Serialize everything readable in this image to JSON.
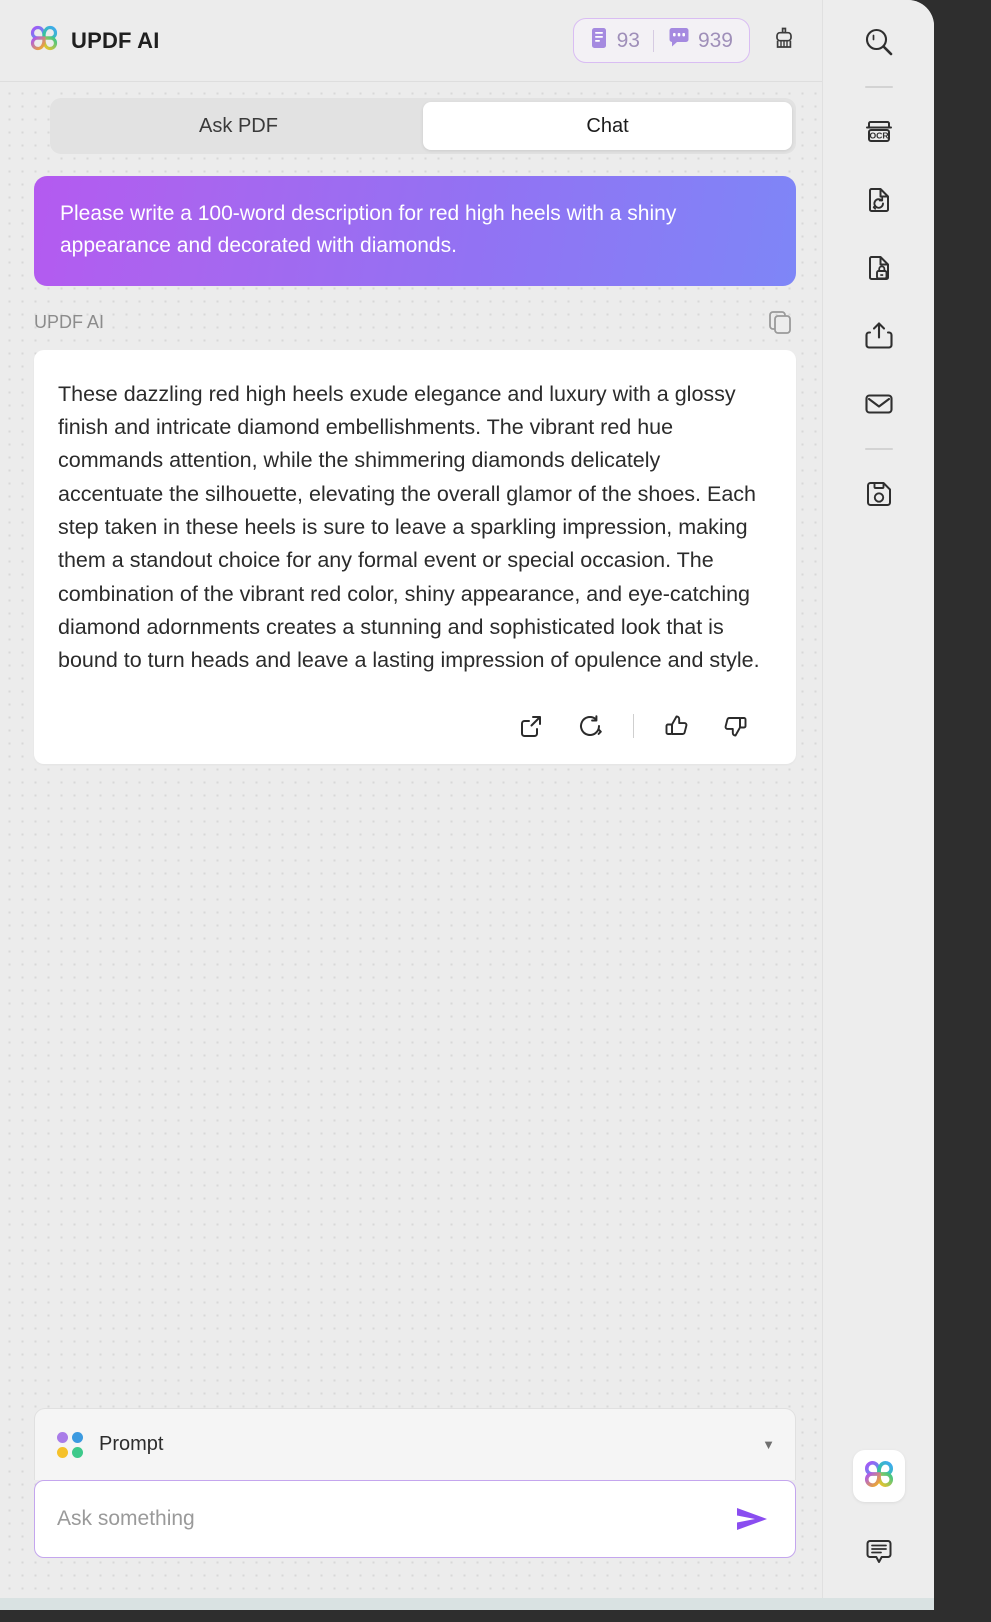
{
  "window": {
    "frame_color": "#2e2e2e",
    "panel_bg": "#ececec"
  },
  "header": {
    "brand_title": "UPDF AI",
    "logo_icon": "updf-clover-logo-icon",
    "counts": [
      {
        "icon": "document-pages-icon",
        "value": "93",
        "color": "#9f8fb9"
      },
      {
        "icon": "chat-bubble-icon",
        "value": "939",
        "color": "#9f8fb9"
      }
    ],
    "clear_icon": "brush-icon",
    "badge_border_color": "#d9bdf3"
  },
  "tabs": [
    {
      "label": "Ask PDF",
      "name": "tab-ask-pdf",
      "active": false
    },
    {
      "label": "Chat",
      "name": "tab-chat",
      "active": true
    }
  ],
  "conversation": {
    "user_message": "Please write a 100-word description for red high heels with a shiny appearance and decorated with diamonds.",
    "user_bubble_gradient_from": "#b45af0",
    "user_bubble_gradient_to": "#7e86f7",
    "assistant_label": "UPDF AI",
    "copy_icon": "copy-icon",
    "assistant_message": "These dazzling red high heels exude elegance and luxury with a glossy finish and intricate diamond embellishments. The vibrant red hue commands attention, while the shimmering diamonds delicately accentuate the silhouette, elevating the overall glamor of the shoes. Each step taken in these heels is sure to leave a sparkling impression, making them a standout choice for any formal event or special occasion. The combination of the vibrant red color, shiny appearance, and eye-catching diamond adornments creates a stunning and sophisticated look that is bound to turn heads and leave a lasting impression of opulence and style.",
    "actions": [
      {
        "name": "insert-to-document-button",
        "icon": "external-link-icon"
      },
      {
        "name": "regenerate-button",
        "icon": "refresh-icon"
      },
      {
        "name": "thumbs-up-button",
        "icon": "thumbs-up-icon"
      },
      {
        "name": "thumbs-down-button",
        "icon": "thumbs-down-icon"
      }
    ]
  },
  "composer": {
    "prompt_label": "Prompt",
    "prompt_icon": "four-color-dots-icon",
    "dot_colors": [
      "#a97ce8",
      "#3c9ae0",
      "#f5c12a",
      "#3ec98b"
    ],
    "dropdown_icon": "chevron-down-icon",
    "input_value": "",
    "input_placeholder": "Ask something",
    "send_icon": "send-arrow-icon",
    "send_color": "#8a4df0",
    "input_border_color": "#c4a6ee"
  },
  "toolrail": {
    "items": [
      {
        "name": "rail-search",
        "icon": "search-icon"
      },
      {
        "name": "rail-divider-1",
        "icon": "divider"
      },
      {
        "name": "rail-ocr",
        "icon": "ocr-icon",
        "label": "OCR"
      },
      {
        "name": "rail-convert",
        "icon": "convert-document-icon"
      },
      {
        "name": "rail-protect",
        "icon": "document-lock-icon"
      },
      {
        "name": "rail-share",
        "icon": "share-upload-icon"
      },
      {
        "name": "rail-email",
        "icon": "envelope-icon"
      },
      {
        "name": "rail-divider-2",
        "icon": "divider"
      },
      {
        "name": "rail-save",
        "icon": "floppy-save-icon"
      }
    ],
    "bottom": [
      {
        "name": "rail-updf-ai",
        "icon": "updf-clover-logo-icon"
      },
      {
        "name": "rail-comments",
        "icon": "comment-bubble-icon"
      }
    ]
  }
}
